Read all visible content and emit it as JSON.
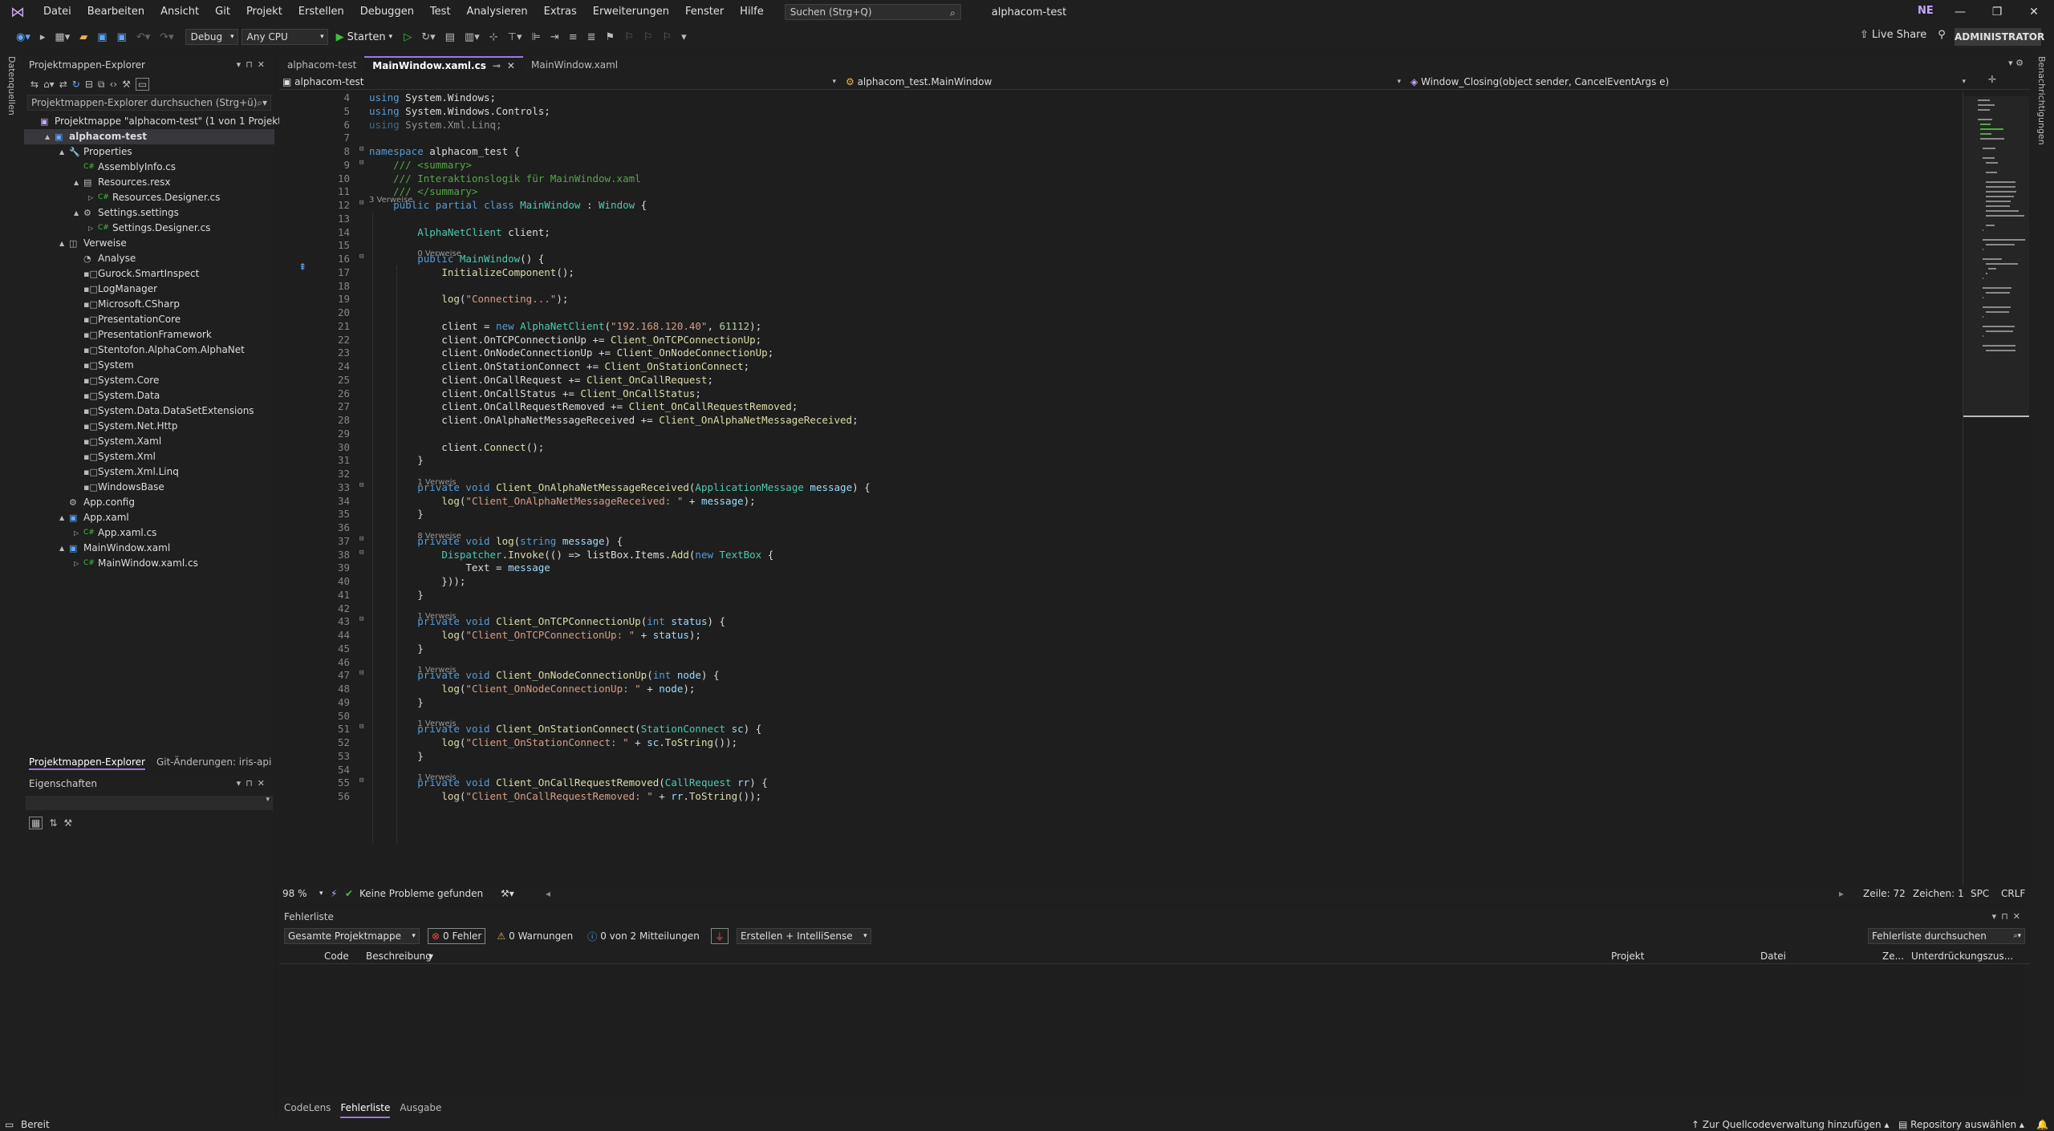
{
  "menu": {
    "items": [
      "Datei",
      "Bearbeiten",
      "Ansicht",
      "Git",
      "Projekt",
      "Erstellen",
      "Debuggen",
      "Test",
      "Analysieren",
      "Extras",
      "Erweiterungen",
      "Fenster",
      "Hilfe"
    ],
    "search_placeholder": "Suchen (Strg+Q)",
    "app_title": "alphacom-test",
    "avatar": "NE"
  },
  "toolbar": {
    "config": "Debug",
    "platform": "Any CPU",
    "start": "Starten",
    "liveshare": "Live Share",
    "admin": "ADMINISTRATOR"
  },
  "side_strips": {
    "left": "Datenquellen",
    "right": "Benachrichtigungen"
  },
  "solution_explorer": {
    "title": "Projektmappen-Explorer",
    "search_placeholder": "Projektmappen-Explorer durchsuchen (Strg+ü)",
    "tree": [
      {
        "label": "Projektmappe \"alphacom-test\" (1 von 1 Projekt)",
        "depth": 0,
        "icon": "solution-icon",
        "expand": ""
      },
      {
        "label": "alphacom-test",
        "depth": 1,
        "icon": "csharp-project-icon",
        "expand": "▲",
        "bold": true
      },
      {
        "label": "Properties",
        "depth": 2,
        "icon": "wrench-icon",
        "expand": "▲"
      },
      {
        "label": "AssemblyInfo.cs",
        "depth": 3,
        "icon": "csharp-file-icon",
        "expand": ""
      },
      {
        "label": "Resources.resx",
        "depth": 3,
        "icon": "resx-icon",
        "expand": "▲"
      },
      {
        "label": "Resources.Designer.cs",
        "depth": 4,
        "icon": "csharp-file-icon",
        "expand": "▷"
      },
      {
        "label": "Settings.settings",
        "depth": 3,
        "icon": "settings-icon",
        "expand": "▲"
      },
      {
        "label": "Settings.Designer.cs",
        "depth": 4,
        "icon": "csharp-file-icon",
        "expand": "▷"
      },
      {
        "label": "Verweise",
        "depth": 2,
        "icon": "references-icon",
        "expand": "▲"
      },
      {
        "label": "Analyse",
        "depth": 3,
        "icon": "analyzer-icon",
        "expand": ""
      },
      {
        "label": "Gurock.SmartInspect",
        "depth": 3,
        "icon": "reference-icon",
        "expand": ""
      },
      {
        "label": "LogManager",
        "depth": 3,
        "icon": "reference-icon",
        "expand": ""
      },
      {
        "label": "Microsoft.CSharp",
        "depth": 3,
        "icon": "reference-icon",
        "expand": ""
      },
      {
        "label": "PresentationCore",
        "depth": 3,
        "icon": "reference-icon",
        "expand": ""
      },
      {
        "label": "PresentationFramework",
        "depth": 3,
        "icon": "reference-icon",
        "expand": ""
      },
      {
        "label": "Stentofon.AlphaCom.AlphaNet",
        "depth": 3,
        "icon": "reference-icon",
        "expand": ""
      },
      {
        "label": "System",
        "depth": 3,
        "icon": "reference-icon",
        "expand": ""
      },
      {
        "label": "System.Core",
        "depth": 3,
        "icon": "reference-icon",
        "expand": ""
      },
      {
        "label": "System.Data",
        "depth": 3,
        "icon": "reference-icon",
        "expand": ""
      },
      {
        "label": "System.Data.DataSetExtensions",
        "depth": 3,
        "icon": "reference-icon",
        "expand": ""
      },
      {
        "label": "System.Net.Http",
        "depth": 3,
        "icon": "reference-icon",
        "expand": ""
      },
      {
        "label": "System.Xaml",
        "depth": 3,
        "icon": "reference-icon",
        "expand": ""
      },
      {
        "label": "System.Xml",
        "depth": 3,
        "icon": "reference-icon",
        "expand": ""
      },
      {
        "label": "System.Xml.Linq",
        "depth": 3,
        "icon": "reference-icon",
        "expand": ""
      },
      {
        "label": "WindowsBase",
        "depth": 3,
        "icon": "reference-icon",
        "expand": ""
      },
      {
        "label": "App.config",
        "depth": 2,
        "icon": "config-file-icon",
        "expand": ""
      },
      {
        "label": "App.xaml",
        "depth": 2,
        "icon": "xaml-file-icon",
        "expand": "▲"
      },
      {
        "label": "App.xaml.cs",
        "depth": 3,
        "icon": "csharp-file-icon",
        "expand": "▷"
      },
      {
        "label": "MainWindow.xaml",
        "depth": 2,
        "icon": "xaml-file-icon",
        "expand": "▲"
      },
      {
        "label": "MainWindow.xaml.cs",
        "depth": 3,
        "icon": "csharp-file-icon",
        "expand": "▷"
      }
    ],
    "bottom_tabs": [
      "Projektmappen-Explorer",
      "Git-Änderungen: iris-api"
    ]
  },
  "properties": {
    "title": "Eigenschaften"
  },
  "editor": {
    "tabs": [
      {
        "label": "alphacom-test",
        "active": false
      },
      {
        "label": "MainWindow.xaml.cs",
        "active": true
      },
      {
        "label": "MainWindow.xaml",
        "active": false
      }
    ],
    "nav": {
      "project": "alphacom-test",
      "class": "alphacom_test.MainWindow",
      "member": "Window_Closing(object sender, CancelEventArgs e)"
    },
    "lines": [
      {
        "n": "4",
        "html": "<span class=\"kw\">using</span> System.Windows;"
      },
      {
        "n": "5",
        "html": "<span class=\"kw\">using</span> System.Windows.Controls;"
      },
      {
        "n": "6",
        "html": "<span class=\"kw\" style=\"opacity:.6\">using</span><span style=\"opacity:.6\"> System.Xml.Linq;</span>"
      },
      {
        "n": "7",
        "html": ""
      },
      {
        "n": "8",
        "html": "<span class=\"kw\">namespace</span> alphacom_test {",
        "fold": true
      },
      {
        "n": "9",
        "html": "    <span class=\"cm\">/// &lt;summary&gt;</span>",
        "fold": true
      },
      {
        "n": "10",
        "html": "    <span class=\"cm\">/// Interaktionslogik für MainWindow.xaml</span>"
      },
      {
        "n": "11",
        "html": "    <span class=\"cm\">/// &lt;/summary&gt;</span>",
        "hint": "3 Verweise"
      },
      {
        "n": "12",
        "html": "    <span class=\"kw\">public partial class</span> <span class=\"ty\">MainWindow</span> : <span class=\"ty\">Window</span> {",
        "fold": true
      },
      {
        "n": "13",
        "html": ""
      },
      {
        "n": "14",
        "html": "        <span class=\"ty\">AlphaNetClient</span> client;"
      },
      {
        "n": "15",
        "html": "",
        "hint": "0 Verweise"
      },
      {
        "n": "16",
        "html": "        <span class=\"kw\">public</span> <span class=\"ty\">MainWindow</span>() {",
        "fold": true
      },
      {
        "n": "17",
        "html": "            <span class=\"mt\">InitializeComponent</span>();"
      },
      {
        "n": "18",
        "html": ""
      },
      {
        "n": "19",
        "html": "            <span class=\"mt\">log</span>(<span class=\"st\">\"Connecting...\"</span>);"
      },
      {
        "n": "20",
        "html": ""
      },
      {
        "n": "21",
        "html": "            client = <span class=\"kw\">new</span> <span class=\"ty\">AlphaNetClient</span>(<span class=\"st\">\"192.168.120.40\"</span>, <span class=\"nm\">61112</span>);"
      },
      {
        "n": "22",
        "html": "            client.OnTCPConnectionUp += <span class=\"mt\">Client_OnTCPConnectionUp</span>;"
      },
      {
        "n": "23",
        "html": "            client.OnNodeConnectionUp += <span class=\"mt\">Client_OnNodeConnectionUp</span>;"
      },
      {
        "n": "24",
        "html": "            client.OnStationConnect += <span class=\"mt\">Client_OnStationConnect</span>;"
      },
      {
        "n": "25",
        "html": "            client.OnCallRequest += <span class=\"mt\">Client_OnCallRequest</span>;"
      },
      {
        "n": "26",
        "html": "            client.OnCallStatus += <span class=\"mt\">Client_OnCallStatus</span>;"
      },
      {
        "n": "27",
        "html": "            client.OnCallRequestRemoved += <span class=\"mt\">Client_OnCallRequestRemoved</span>;"
      },
      {
        "n": "28",
        "html": "            client.OnAlphaNetMessageReceived += <span class=\"mt\">Client_OnAlphaNetMessageReceived</span>;"
      },
      {
        "n": "29",
        "html": ""
      },
      {
        "n": "30",
        "html": "            client.<span class=\"mt\">Connect</span>();"
      },
      {
        "n": "31",
        "html": "        }"
      },
      {
        "n": "32",
        "html": "",
        "hint": "1 Verweis"
      },
      {
        "n": "33",
        "html": "        <span class=\"kw\">private void</span> <span class=\"mt\">Client_OnAlphaNetMessageReceived</span>(<span class=\"ty\">ApplicationMessage</span> <span class=\"pm\">message</span>) {",
        "fold": true
      },
      {
        "n": "34",
        "html": "            <span class=\"mt\">log</span>(<span class=\"st\">\"Client_OnAlphaNetMessageReceived: \"</span> + <span class=\"pm\">message</span>);"
      },
      {
        "n": "35",
        "html": "        }"
      },
      {
        "n": "36",
        "html": "",
        "hint": "8 Verweise"
      },
      {
        "n": "37",
        "html": "        <span class=\"kw\">private void</span> <span class=\"mt\">log</span>(<span class=\"kw\">string</span> <span class=\"pm\">message</span>) {",
        "fold": true
      },
      {
        "n": "38",
        "html": "            <span class=\"ty\">Dispatcher</span>.<span class=\"mt\">Invoke</span>(() =&gt; listBox.Items.<span class=\"mt\">Add</span>(<span class=\"kw\">new</span> <span class=\"ty\">TextBox</span> {",
        "fold": true
      },
      {
        "n": "39",
        "html": "                Text = <span class=\"pm\">message</span>"
      },
      {
        "n": "40",
        "html": "            }));"
      },
      {
        "n": "41",
        "html": "        }"
      },
      {
        "n": "42",
        "html": "",
        "hint": "1 Verweis"
      },
      {
        "n": "43",
        "html": "        <span class=\"kw\">private void</span> <span class=\"mt\">Client_OnTCPConnectionUp</span>(<span class=\"kw\">int</span> <span class=\"pm\">status</span>) {",
        "fold": true
      },
      {
        "n": "44",
        "html": "            <span class=\"mt\">log</span>(<span class=\"st\">\"Client_OnTCPConnectionUp: \"</span> + <span class=\"pm\">status</span>);"
      },
      {
        "n": "45",
        "html": "        }"
      },
      {
        "n": "46",
        "html": "",
        "hint": "1 Verweis"
      },
      {
        "n": "47",
        "html": "        <span class=\"kw\">private void</span> <span class=\"mt\">Client_OnNodeConnectionUp</span>(<span class=\"kw\">int</span> <span class=\"pm\">node</span>) {",
        "fold": true
      },
      {
        "n": "48",
        "html": "            <span class=\"mt\">log</span>(<span class=\"st\">\"Client_OnNodeConnectionUp: \"</span> + <span class=\"pm\">node</span>);"
      },
      {
        "n": "49",
        "html": "        }"
      },
      {
        "n": "50",
        "html": "",
        "hint": "1 Verweis"
      },
      {
        "n": "51",
        "html": "        <span class=\"kw\">private void</span> <span class=\"mt\">Client_OnStationConnect</span>(<span class=\"ty\">StationConnect</span> <span class=\"pm\">sc</span>) {",
        "fold": true
      },
      {
        "n": "52",
        "html": "            <span class=\"mt\">log</span>(<span class=\"st\">\"Client_OnStationConnect: \"</span> + <span class=\"pm\">sc</span>.<span class=\"mt\">ToString</span>());"
      },
      {
        "n": "53",
        "html": "        }"
      },
      {
        "n": "54",
        "html": "",
        "hint": "1 Verweis"
      },
      {
        "n": "55",
        "html": "        <span class=\"kw\">private void</span> <span class=\"mt\">Client_OnCallRequestRemoved</span>(<span class=\"ty\">CallRequest</span> <span class=\"pm\">rr</span>) {",
        "fold": true
      },
      {
        "n": "56",
        "html": "            <span class=\"mt\">log</span>(<span class=\"st\">\"Client_OnCallRequestRemoved: \"</span> + <span class=\"pm\">rr</span>.<span class=\"mt\">ToString</span>());"
      }
    ],
    "status": {
      "zoom": "98 %",
      "problems": "Keine Probleme gefunden",
      "line": "Zeile: 72",
      "char": "Zeichen: 1",
      "spc": "SPC",
      "eol": "CRLF"
    }
  },
  "error_list": {
    "title": "Fehlerliste",
    "scope": "Gesamte Projektmappe",
    "errors": "0 Fehler",
    "warnings": "0 Warnungen",
    "messages": "0 von 2 Mitteilungen",
    "build": "Erstellen + IntelliSense",
    "search_placeholder": "Fehlerliste durchsuchen",
    "columns": [
      "Code",
      "Beschreibung",
      "Projekt",
      "Datei",
      "Ze...",
      "Unterdrückungszus..."
    ],
    "tabs": [
      "CodeLens",
      "Fehlerliste",
      "Ausgabe"
    ]
  },
  "statusbar": {
    "ready": "Bereit",
    "scm": "Zur Quellcodeverwaltung hinzufügen",
    "repo": "Repository auswählen"
  }
}
